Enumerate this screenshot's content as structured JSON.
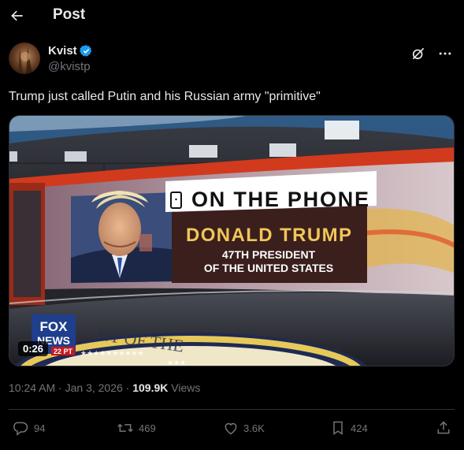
{
  "header": {
    "title": "Post",
    "back_icon": "arrow-left-icon"
  },
  "author": {
    "display_name": "Kvist",
    "handle": "@kvistp",
    "verified_color": "#1d9bf0"
  },
  "post": {
    "text": "Trump just called Putin and his Russian army \"primitive\""
  },
  "media": {
    "banner": "ON THE PHONE",
    "lower_third_name": "DONALD TRUMP",
    "lower_third_title_line1": "47TH PRESIDENT",
    "lower_third_title_line2": "OF THE UNITED STATES",
    "network_logo_line1": "FOX",
    "network_logo_line2": "NEWS",
    "time_tag": "22 PT",
    "seal_text": "NT OF THE",
    "duration": "0:26"
  },
  "meta": {
    "time": "10:24 AM",
    "date": "Jan 3, 2026",
    "views_count": "109.9K",
    "views_label": "Views",
    "separator": "·"
  },
  "stats": {
    "replies": "94",
    "reposts": "469",
    "likes": "3.6K",
    "bookmarks": "424"
  }
}
